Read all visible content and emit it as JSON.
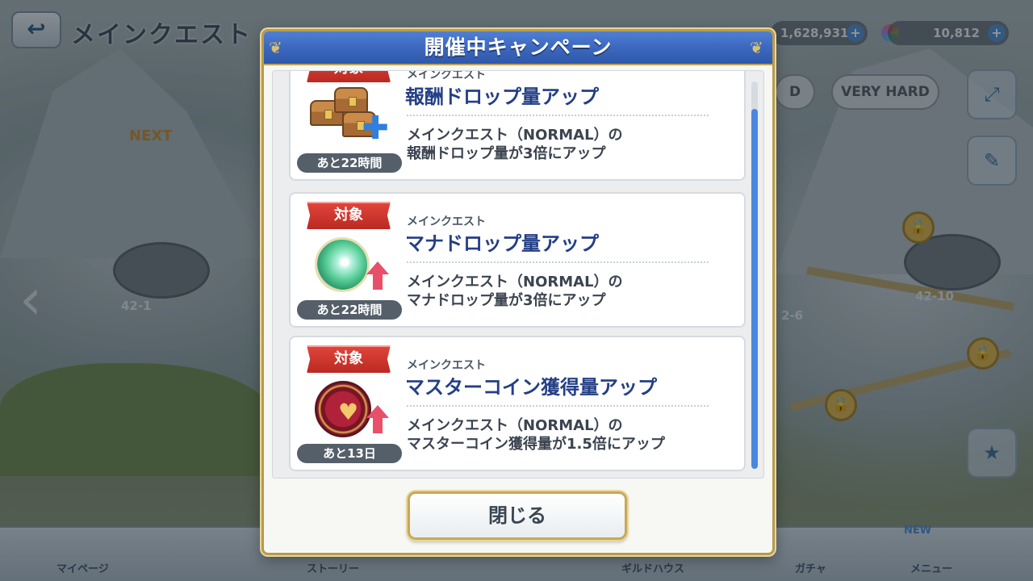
{
  "background": {
    "screen_title": "メインクエスト",
    "back_icon": "back-arrow-icon",
    "currency": {
      "mana": "1,628,931",
      "jewels": "10,812"
    },
    "difficulty": {
      "hard_partial": "D",
      "very_hard": "VERY HARD"
    },
    "map": {
      "next_label": "NEXT",
      "node_left": "42-1",
      "node_right": "42-10",
      "node_mid": "2-6"
    },
    "bottom_nav": [
      "マイページ",
      "ギルドハウス",
      "ストーリー",
      "ガチャ",
      "メニュー"
    ],
    "new_badge": "NEW"
  },
  "dialog": {
    "title": "開催中キャンペーン",
    "close_label": "閉じる",
    "campaigns": [
      {
        "tag": "対象",
        "category": "メインクエスト",
        "title": "報酬ドロップ量アップ",
        "description_line1": "メインクエスト（NORMAL）の",
        "description_line2": "報酬ドロップ量が3倍にアップ",
        "time_left": "あと22時間",
        "icon": "treasure-chest-icon"
      },
      {
        "tag": "対象",
        "category": "メインクエスト",
        "title": "マナドロップ量アップ",
        "description_line1": "メインクエスト（NORMAL）の",
        "description_line2": "マナドロップ量が3倍にアップ",
        "time_left": "あと22時間",
        "icon": "mana-orb-icon"
      },
      {
        "tag": "対象",
        "category": "メインクエスト",
        "title": "マスターコイン獲得量アップ",
        "description_line1": "メインクエスト（NORMAL）の",
        "description_line2": "マスターコイン獲得量が1.5倍にアップ",
        "time_left": "あと13日",
        "icon": "master-coin-icon"
      }
    ]
  },
  "colors": {
    "header_blue": "#3a66bd",
    "tag_red": "#c8332b",
    "title_navy": "#243f86",
    "gold_border": "#b89a4e"
  }
}
